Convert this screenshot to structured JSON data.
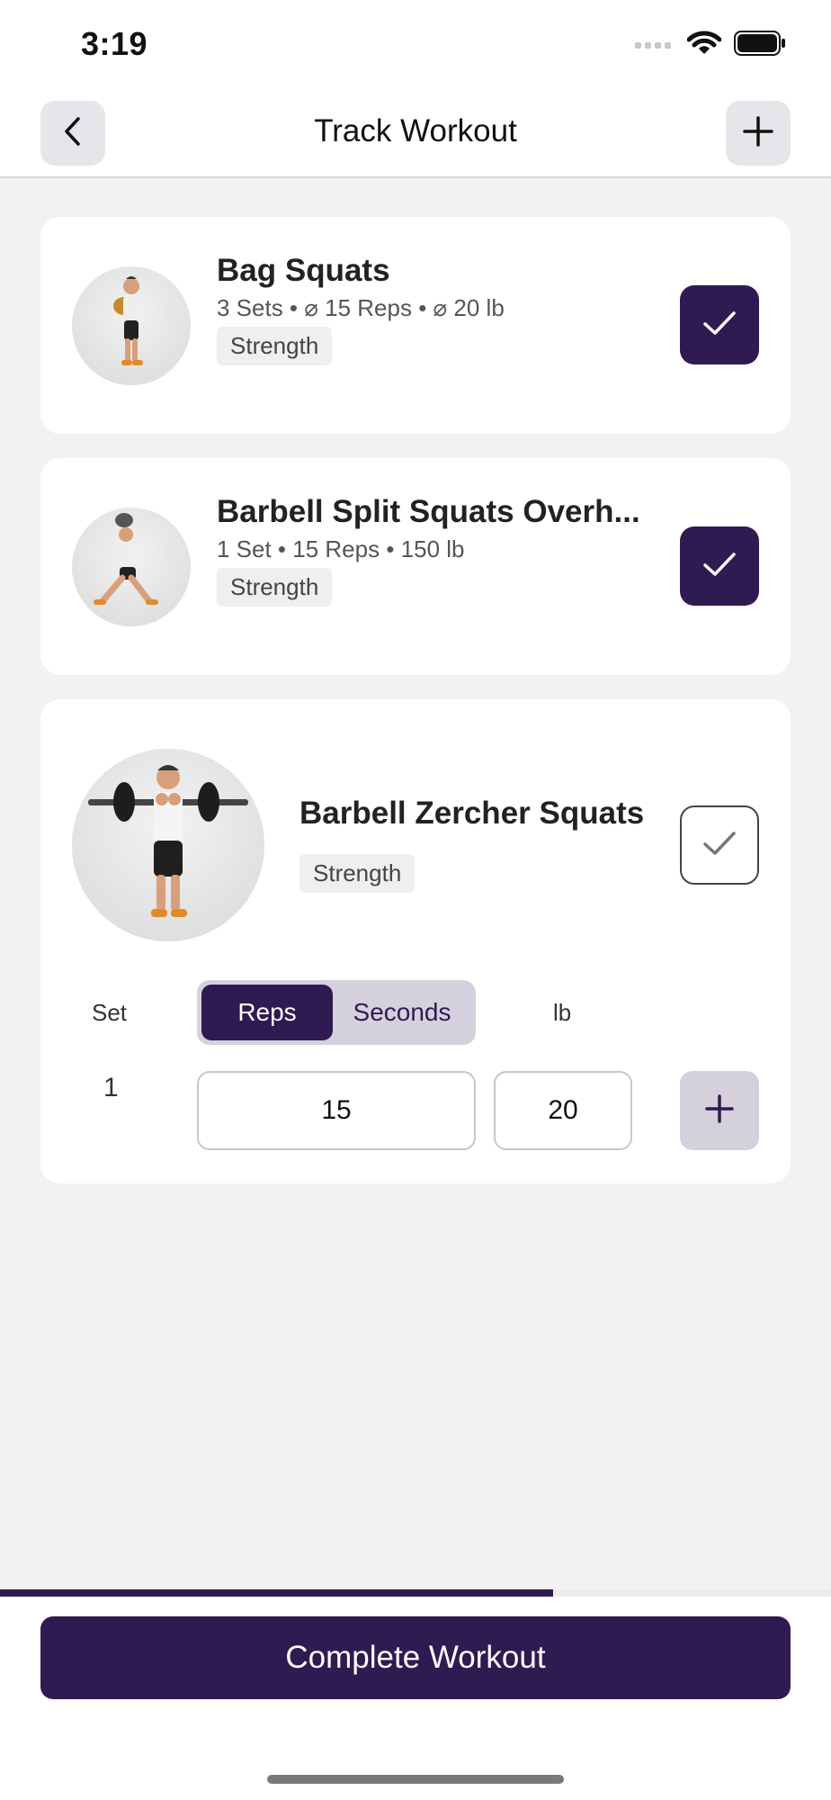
{
  "status_bar": {
    "time": "3:19",
    "icons": [
      "signal-icon",
      "wifi-icon",
      "battery-icon"
    ]
  },
  "nav": {
    "title": "Track Workout",
    "back_icon": "chevron-left-icon",
    "add_icon": "plus-icon"
  },
  "exercises": [
    {
      "name": "Bag Squats",
      "summary": "3 Sets • ⌀ 15 Reps • ⌀ 20 lb",
      "tag": "Strength",
      "completed": true
    },
    {
      "name": "Barbell Split Squats Overh...",
      "summary": "1 Set • 15 Reps • 150 lb",
      "tag": "Strength",
      "completed": true
    },
    {
      "name": "Barbell Zercher Squats",
      "tag": "Strength",
      "completed": false,
      "columns": {
        "set": "Set",
        "reps_toggle": "Reps",
        "seconds_toggle": "Seconds",
        "weight": "lb"
      },
      "sets": [
        {
          "number": "1",
          "reps": "15",
          "weight": "20"
        }
      ]
    }
  ],
  "progress": 0.666,
  "complete_button": "Complete Workout",
  "colors": {
    "accent": "#2f1b52",
    "accent_light": "#d4d1dc",
    "background": "#f2f2f2",
    "card": "#ffffff"
  }
}
